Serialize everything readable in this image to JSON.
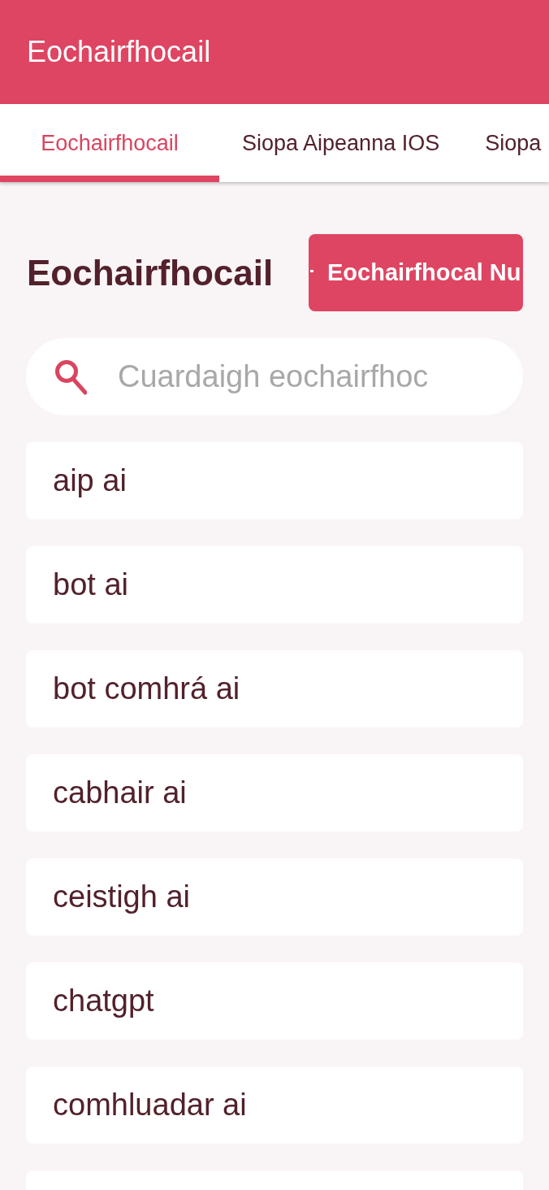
{
  "app_bar": {
    "title": "Eochairfhocail"
  },
  "tabs": [
    {
      "label": "Eochairfhocail",
      "selected": true
    },
    {
      "label": "Siopa Aipeanna IOS",
      "selected": false
    },
    {
      "label": "Siopa",
      "selected": false
    }
  ],
  "page": {
    "heading": "Eochairfhocail",
    "new_button": "Eochairfhocal Nu"
  },
  "search": {
    "placeholder": "Cuardaigh eochairfhoc"
  },
  "keywords": [
    "aip ai",
    "bot ai",
    "bot comhrá ai",
    "cabhair ai",
    "ceistigh ai",
    "chatgpt",
    "comhluadar ai"
  ]
}
